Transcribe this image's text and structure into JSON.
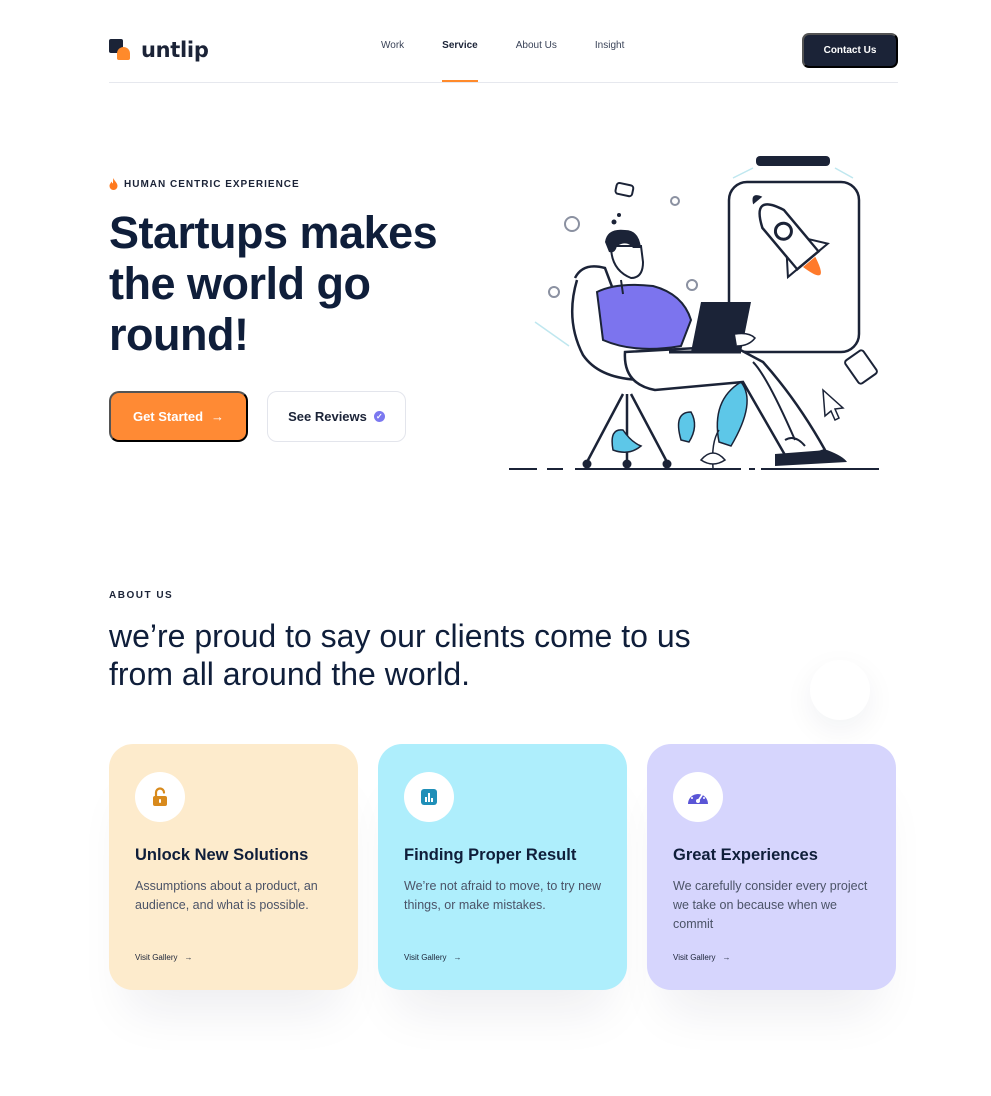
{
  "brand": {
    "name": "untlip",
    "accent": "#ff8a34",
    "dark": "#1b2337"
  },
  "nav": {
    "items": [
      {
        "label": "Work"
      },
      {
        "label": "Service"
      },
      {
        "label": "About Us"
      },
      {
        "label": "Insight"
      }
    ],
    "active": "Service",
    "contact_label": "Contact Us"
  },
  "hero": {
    "eyebrow": "HUMAN CENTRIC EXPERIENCE",
    "title": "Startups makes the world go round!",
    "primary_button": "Get Started",
    "secondary_button": "See Reviews"
  },
  "about": {
    "label": "ABOUT US",
    "title": "we’re proud to say our clients come to us from all around the world."
  },
  "cards": [
    {
      "title": "Unlock New Solutions",
      "text": "Assumptions about a product, an audience, and what is possible.",
      "link": "Visit Gallery",
      "color": "#fdebcc",
      "icon": "lock-icon",
      "icon_color": "#d88a1c"
    },
    {
      "title": "Finding Proper Result",
      "text": "We’re not afraid to move, to try new things, or make mistakes.",
      "link": "Visit Gallery",
      "color": "#aeeefc",
      "icon": "chart-icon",
      "icon_color": "#1f8fb8"
    },
    {
      "title": "Great Experiences",
      "text": "We carefully consider every project we take on because when we commit",
      "link": "Visit Gallery",
      "color": "#d6d5fd",
      "icon": "gauge-icon",
      "icon_color": "#5a55d6"
    }
  ]
}
